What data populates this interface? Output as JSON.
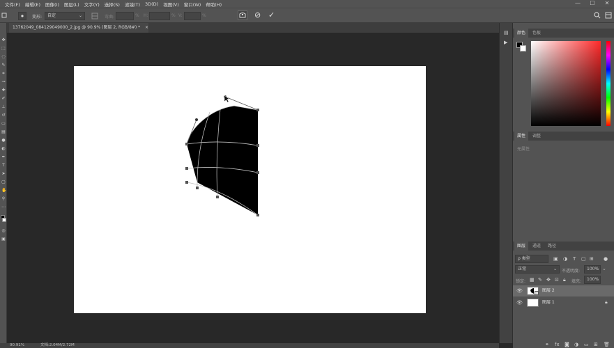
{
  "menu": [
    "文件(F)",
    "编辑(E)",
    "图像(I)",
    "图层(L)",
    "文字(Y)",
    "选择(S)",
    "滤镜(T)",
    "3D(D)",
    "视图(V)",
    "窗口(W)",
    "帮助(H)"
  ],
  "window_controls": {
    "minimize": "—",
    "maximize": "☐",
    "close": "✕"
  },
  "options": {
    "mode_label": "变形:",
    "mode_value": "自定",
    "field1_label": "弯曲:",
    "field1_unit": "%",
    "field2_label": "H:",
    "field2_unit": "%",
    "field3_label": "V:",
    "field3_unit": "%",
    "cancel_icon": "⊘",
    "commit_icon": "✓"
  },
  "document_tab": {
    "title": "13762049_084129049000_2.jpg @ 90.9% (图层 2, RGB/8#) *",
    "close": "×"
  },
  "status": {
    "zoom": "90.91%",
    "doc_info": "文档:2.04M/2.72M"
  },
  "panels": {
    "color_tabs": [
      "颜色",
      "色板"
    ],
    "properties_tabs": [
      "属性",
      "调整"
    ],
    "properties_empty": "无属性",
    "layers_tabs": [
      "图层",
      "通道",
      "路径"
    ],
    "filter_placeholder": "ρ 类型",
    "blend_mode": "正常",
    "opacity_label": "不透明度:",
    "opacity_value": "100%",
    "lock_label": "锁定:",
    "fill_label": "填充:",
    "fill_value": "100%",
    "layers": [
      {
        "name": "图层 2",
        "selected": true
      },
      {
        "name": "图层 1",
        "selected": false,
        "locked": true
      }
    ]
  },
  "colors": {
    "accent_red": "#ff2a2a",
    "foreground": "#000000",
    "background": "#ffffff"
  }
}
